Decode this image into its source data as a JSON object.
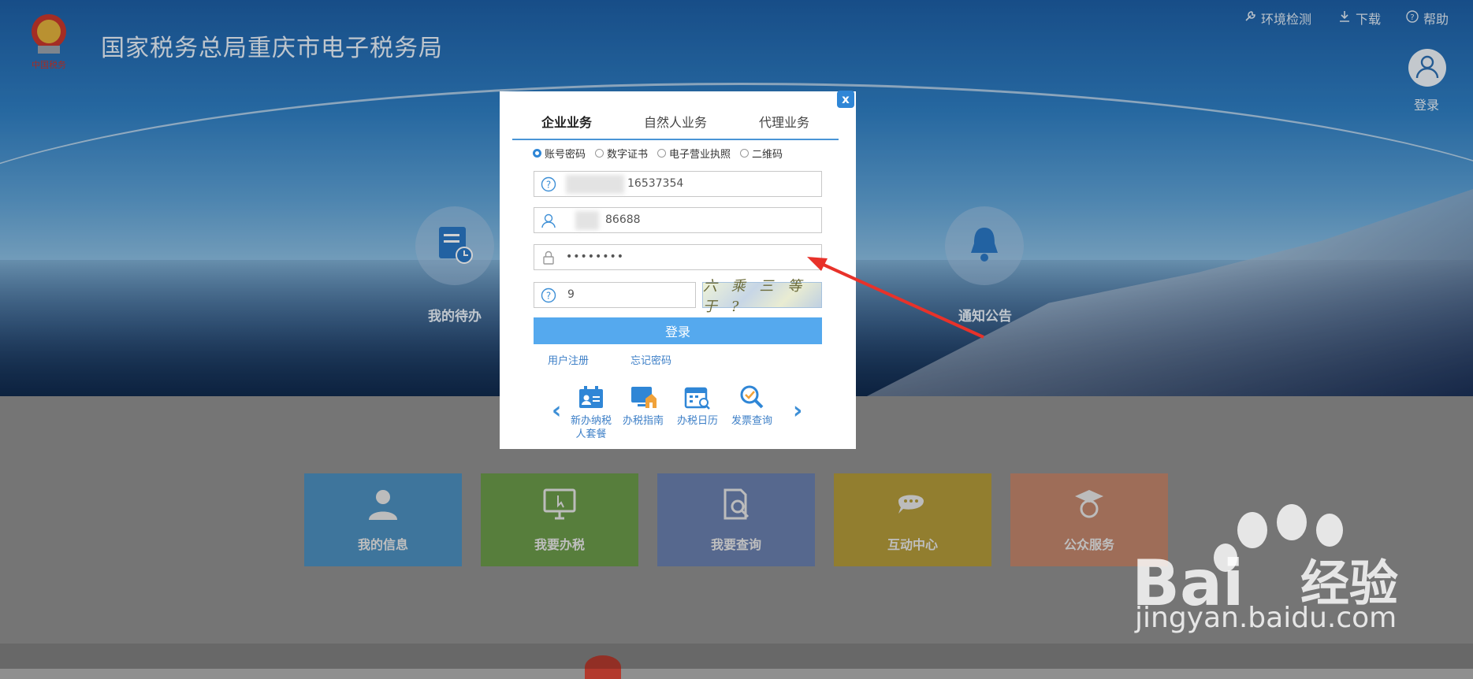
{
  "header": {
    "title": "国家税务总局重庆市电子税务局",
    "env_check": "环境检测",
    "download": "下载",
    "help": "帮助",
    "login_label": "登录"
  },
  "hero": {
    "todo": "我的待办",
    "notice": "通知公告"
  },
  "tiles": [
    {
      "label": "我的信息",
      "color": "#4c8fbf"
    },
    {
      "label": "我要办税",
      "color": "#6b9a4a"
    },
    {
      "label": "我要查询",
      "color": "#6a7fae"
    },
    {
      "label": "互动中心",
      "color": "#b39a3a"
    },
    {
      "label": "公众服务",
      "color": "#c1856c"
    }
  ],
  "modal": {
    "close": "x",
    "tabs": [
      "企业业务",
      "自然人业务",
      "代理业务"
    ],
    "login_types": [
      "账号密码",
      "数字证书",
      "电子营业执照",
      "二维码"
    ],
    "taxpayer_id_value": "16537354",
    "username_value": "86688",
    "password_value": "••••••••",
    "captcha_value": "9",
    "captcha_image_text": "六 乘 三 等于 ?",
    "login_button": "登录",
    "register_link": "用户注册",
    "forgot_link": "忘记密码",
    "quick_links": [
      "新办纳税人套餐",
      "办税指南",
      "办税日历",
      "发票查询"
    ]
  },
  "colors": {
    "accent": "#2f86d6",
    "login_button": "#55a9ee",
    "annotation_arrow": "#e8322a"
  },
  "watermark": {
    "brand": "Bai",
    "brand_cn": "经验",
    "url": "jingyan.baidu.com"
  }
}
